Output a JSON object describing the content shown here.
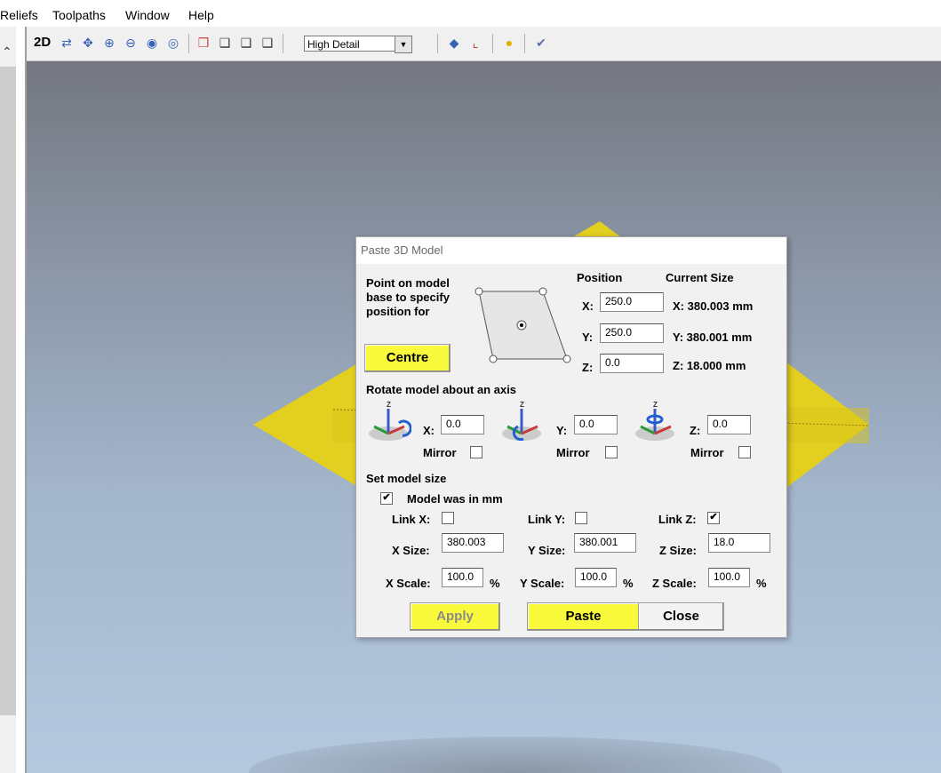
{
  "menu": [
    "Reliefs",
    "Toolpaths",
    "Window",
    "Help"
  ],
  "toolbar": {
    "mode_2d": "2D",
    "detail": "High Detail"
  },
  "icons": [
    "scroll-up-icon",
    "rotate-icon",
    "pan-icon",
    "zoom-in-icon",
    "zoom-out-icon",
    "zoom-region-icon",
    "zoom-fit-icon",
    "view-iso-icon",
    "view-front-icon",
    "view-side-icon",
    "view-top-icon",
    "shaded-view-icon",
    "axes-icon",
    "light-icon",
    "material-icon"
  ],
  "dialog": {
    "title": "Paste 3D Model",
    "point_label": "Point on model base to specify position for",
    "centre_label": "Centre",
    "position_header": "Position",
    "current_size_header": "Current Size",
    "pos_x_label": "X:",
    "pos_x": "250.0",
    "pos_y_label": "Y:",
    "pos_y": "250.0",
    "pos_z_label": "Z:",
    "pos_z": "0.0",
    "size_x_text": "X: 380.003 mm",
    "size_y_text": "Y: 380.001 mm",
    "size_z_text": "Z: 18.000 mm",
    "rotate_header": "Rotate model about an axis",
    "rot_x_label": "X:",
    "rot_x": "0.0",
    "rot_y_label": "Y:",
    "rot_y": "0.0",
    "rot_z_label": "Z:",
    "rot_z": "0.0",
    "mirror_label": "Mirror",
    "set_size_header": "Set model size",
    "model_mm_label": "Model was in mm",
    "link_x_label": "Link X:",
    "link_y_label": "Link Y:",
    "link_z_label": "Link Z:",
    "x_size_label": "X Size:",
    "x_size": "380.003",
    "y_size_label": "Y Size:",
    "y_size": "380.001",
    "z_size_label": "Z Size:",
    "z_size": "18.0",
    "x_scale_label": "X Scale:",
    "x_scale": "100.0",
    "y_scale_label": "Y Scale:",
    "y_scale": "100.0",
    "z_scale_label": "Z Scale:",
    "z_scale": "100.0",
    "percent": "%",
    "apply_label": "Apply",
    "paste_label": "Paste",
    "close_label": "Close",
    "checked": "✔",
    "model_mm_checked": true,
    "link_x_checked": false,
    "link_y_checked": false,
    "link_z_checked": true,
    "mirror_x_checked": false,
    "mirror_y_checked": false,
    "mirror_z_checked": false
  },
  "colors": {
    "model_yellow": "#e6d21e",
    "highlight": "#fafa3c"
  }
}
